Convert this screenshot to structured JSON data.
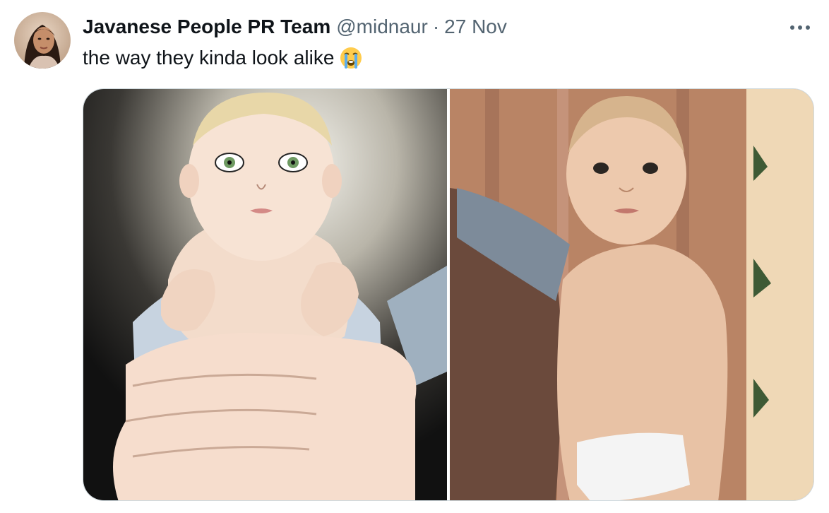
{
  "tweet": {
    "author": {
      "display_name": "Javanese People PR Team",
      "handle": "@midnaur",
      "avatar_icon": "profile-photo-avatar"
    },
    "separator": "·",
    "date": "27 Nov",
    "more_icon": "more-horizontal-icon",
    "text": "the way they kinda look alike",
    "emoji_icon": "loudly-crying-face-emoji"
  },
  "media": {
    "count": 2,
    "images": [
      {
        "icon": "illustrated-baby-image"
      },
      {
        "icon": "baby-photo-image"
      }
    ]
  },
  "colors": {
    "text_primary": "#0f1419",
    "text_secondary": "#536471",
    "border": "#cfd9de",
    "background": "#ffffff"
  }
}
